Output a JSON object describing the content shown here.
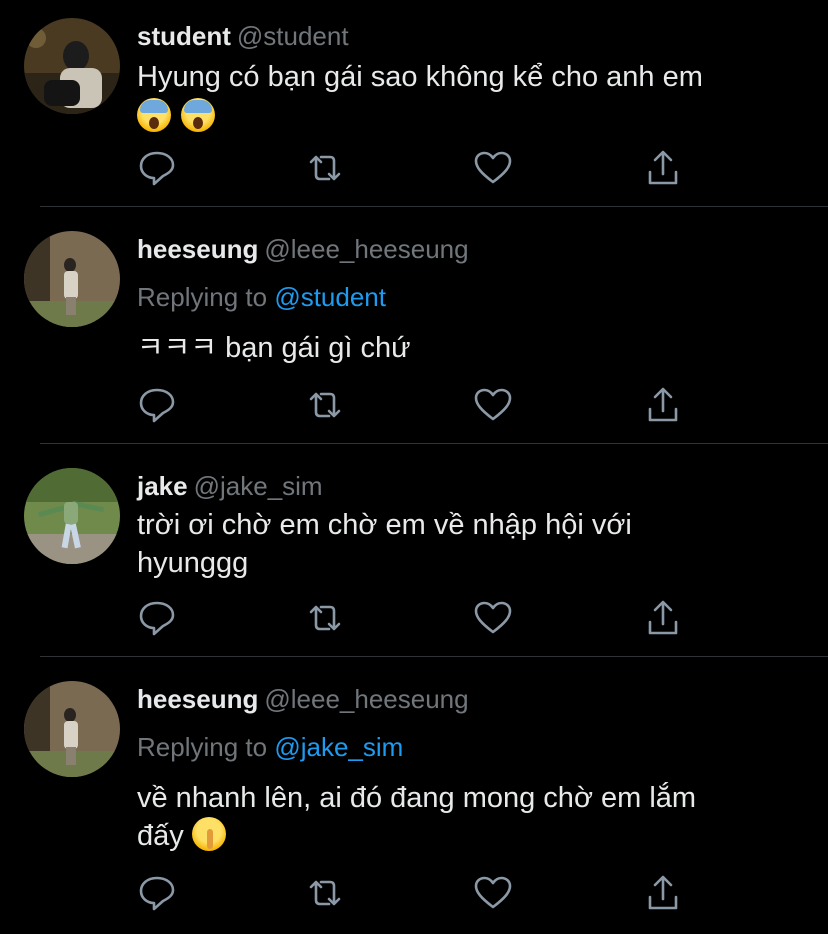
{
  "tweets": [
    {
      "name": "student",
      "handle": "@student",
      "text": "Hyung có bạn gái sao không kể cho anh em",
      "emoji": [
        "face-screaming-in-fear",
        "face-screaming-in-fear"
      ]
    },
    {
      "name": "heeseung",
      "handle": "@leee_heeseung",
      "reply_prefix": "Replying to",
      "reply_to": "@student",
      "text": "ㅋㅋㅋ bạn gái gì chứ"
    },
    {
      "name": "jake",
      "handle": "@jake_sim",
      "text_line1": "trời ơi chờ em chờ em về nhập hội với",
      "text_line2": "hyunggg"
    },
    {
      "name": "heeseung",
      "handle": "@leee_heeseung",
      "reply_prefix": "Replying to",
      "reply_to": "@jake_sim",
      "text_line1": "về nhanh lên, ai đó đang mong chờ em lắm",
      "text_line2": "đấy",
      "emoji": [
        "shushing-face"
      ]
    }
  ],
  "icons": [
    "reply-icon",
    "retweet-icon",
    "like-icon",
    "share-icon"
  ],
  "colors": {
    "background": "#000000",
    "text": "#e7e9ea",
    "muted": "#71767b",
    "link": "#1d9bf0",
    "divider": "#2f3336"
  }
}
